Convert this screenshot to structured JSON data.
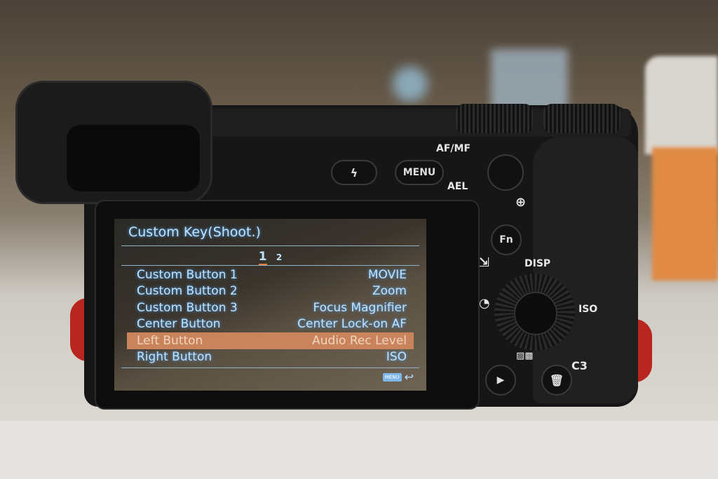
{
  "camera": {
    "labels": {
      "af_mf": "AF/MF",
      "ael": "AEL",
      "menu": "MENU",
      "fn": "Fn",
      "disp": "DISP",
      "iso": "ISO",
      "c3": "C3"
    }
  },
  "screen": {
    "title": "Custom Key(Shoot.)",
    "tabs": [
      {
        "label": "1",
        "active": true
      },
      {
        "label": "2",
        "active": false
      }
    ],
    "rows": [
      {
        "label": "Custom Button 1",
        "value": "MOVIE",
        "selected": false
      },
      {
        "label": "Custom Button 2",
        "value": "Zoom",
        "selected": false
      },
      {
        "label": "Custom Button 3",
        "value": "Focus Magnifier",
        "selected": false
      },
      {
        "label": "Center Button",
        "value": "Center Lock-on AF",
        "selected": false
      },
      {
        "label": "Left Button",
        "value": "Audio Rec Level",
        "selected": true
      },
      {
        "label": "Right Button",
        "value": "ISO",
        "selected": false
      }
    ],
    "footer": {
      "menu_badge": "MENU",
      "back_icon": "return-arrow-icon"
    },
    "colors": {
      "text": "#bfe3ff",
      "highlight": "#c9845b",
      "tab_underline": "#e07b3c"
    }
  }
}
